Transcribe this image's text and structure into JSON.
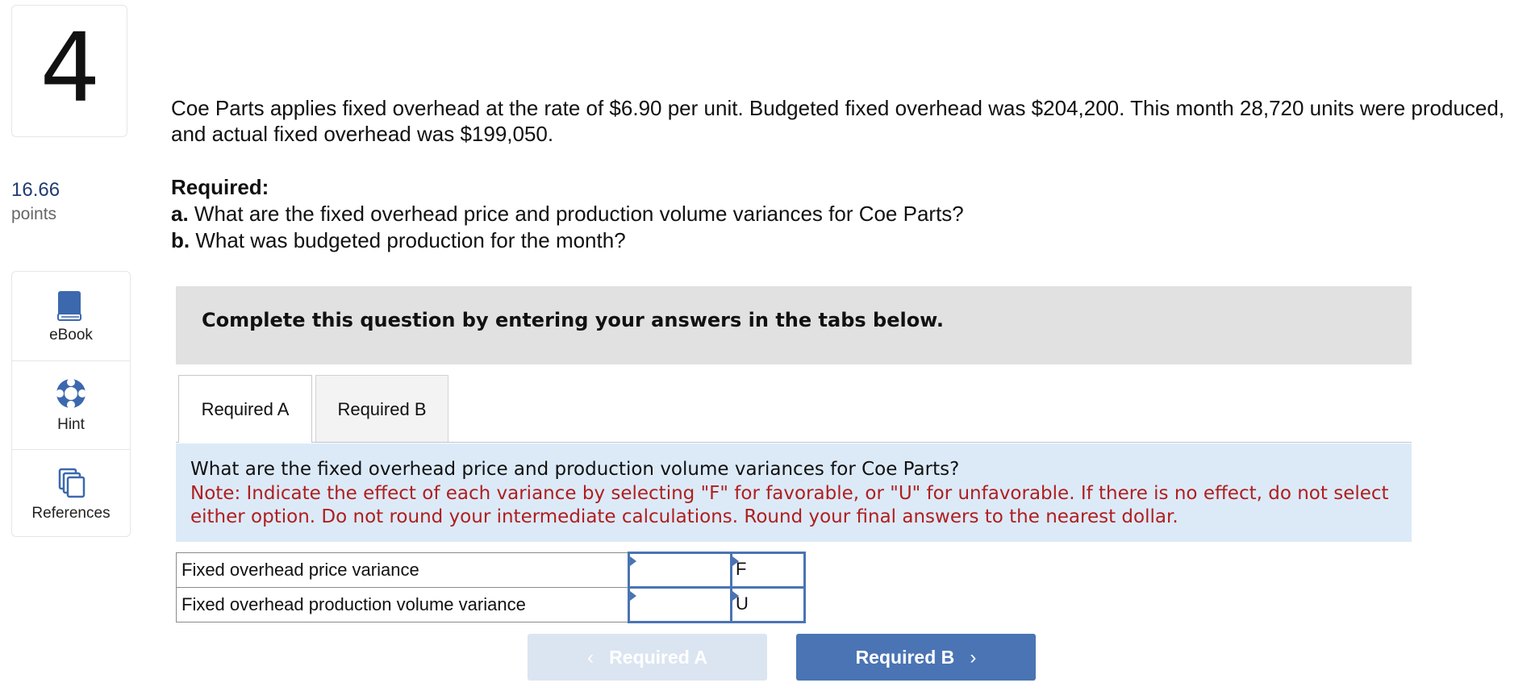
{
  "question": {
    "number": "4",
    "points_value": "16.66",
    "points_label": "points",
    "prompt": "Coe Parts applies fixed overhead at the rate of $6.90 per unit. Budgeted fixed overhead was $204,200. This month 28,720 units were produced, and actual fixed overhead was $199,050.",
    "required_heading": "Required:",
    "req_a_prefix": "a.",
    "req_a_text": " What are the fixed overhead price and production volume variances for Coe Parts?",
    "req_b_prefix": "b.",
    "req_b_text": " What was budgeted production for the month?"
  },
  "tools": [
    {
      "label": "eBook",
      "icon": "book-icon"
    },
    {
      "label": "Hint",
      "icon": "lifebuoy-icon"
    },
    {
      "label": "References",
      "icon": "documents-icon"
    }
  ],
  "banner": "Complete this question by entering your answers in the tabs below.",
  "tabs": [
    {
      "label": "Required A",
      "active": true
    },
    {
      "label": "Required B",
      "active": false
    }
  ],
  "instructions": {
    "question": "What are the fixed overhead price and production volume variances for Coe Parts?",
    "note": "Note: Indicate the effect of each variance by selecting \"F\" for favorable, or \"U\" for unfavorable. If there is no effect, do not select either option. Do not round your intermediate calculations. Round your final answers to the nearest dollar."
  },
  "answer_rows": [
    {
      "label": "Fixed overhead price variance",
      "amount": "",
      "effect": "F"
    },
    {
      "label": "Fixed overhead production volume variance",
      "amount": "",
      "effect": "U"
    }
  ],
  "nav": {
    "prev_label": "Required A",
    "next_label": "Required B"
  },
  "colors": {
    "accent": "#4a74b4",
    "note_red": "#b01e1e",
    "instr_bg": "#dceaf8",
    "banner_bg": "#e1e1e1"
  }
}
